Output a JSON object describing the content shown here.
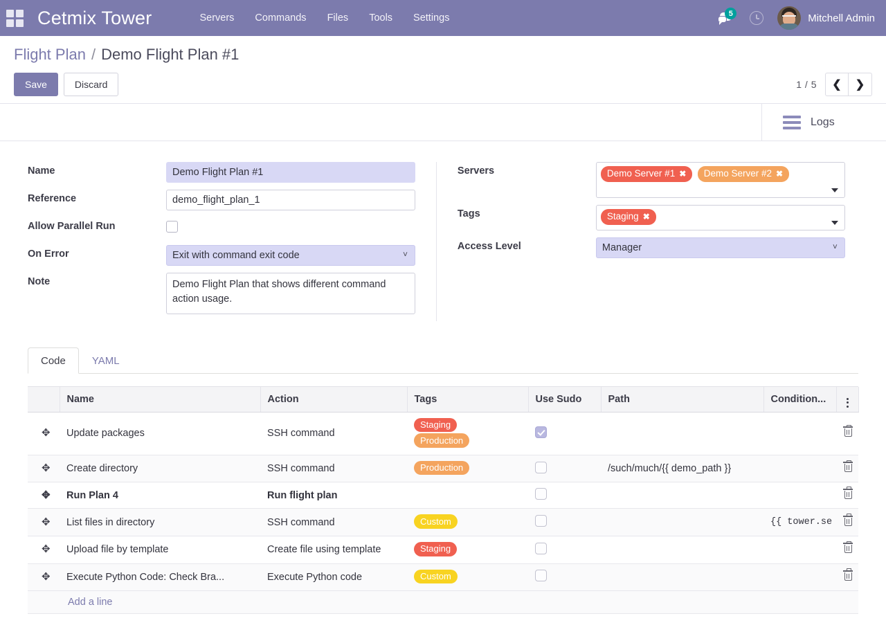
{
  "navbar": {
    "apps_icon": "apps-grid-icon",
    "brand": "Cetmix Tower",
    "menu": [
      "Servers",
      "Commands",
      "Files",
      "Tools",
      "Settings"
    ],
    "messages_icon": "messages-icon",
    "messages_count": "5",
    "activity_icon": "clock-icon",
    "user_name": "Mitchell Admin",
    "avatar_icon": "user-avatar"
  },
  "control_panel": {
    "breadcrumb_root": "Flight Plan",
    "breadcrumb_sep": "/",
    "breadcrumb_current": "Demo Flight Plan #1",
    "save_label": "Save",
    "discard_label": "Discard",
    "pager_value": "1 / 5",
    "prev_icon": "chevron-left-icon",
    "next_icon": "chevron-right-icon"
  },
  "statusbar": {
    "logs_icon": "list-lines-icon",
    "logs_label": "Logs"
  },
  "form": {
    "left": {
      "name_label": "Name",
      "name_value": "Demo Flight Plan #1",
      "reference_label": "Reference",
      "reference_value": "demo_flight_plan_1",
      "allow_parallel_label": "Allow Parallel Run",
      "allow_parallel_checked": false,
      "on_error_label": "On Error",
      "on_error_value": "Exit with command exit code",
      "note_label": "Note",
      "note_value": "Demo Flight Plan that shows different command action usage."
    },
    "right": {
      "servers_label": "Servers",
      "servers_tags": [
        {
          "label": "Demo Server #1",
          "color": "#f06050",
          "remove_icon": "remove-tag-icon"
        },
        {
          "label": "Demo Server #2",
          "color": "#f4a45e",
          "remove_icon": "remove-tag-icon"
        }
      ],
      "tags_label": "Tags",
      "tags_tags": [
        {
          "label": "Staging",
          "color": "#f06050",
          "remove_icon": "remove-tag-icon"
        }
      ],
      "access_level_label": "Access Level",
      "access_level_value": "Manager"
    }
  },
  "notebook": {
    "tabs": [
      {
        "label": "Code",
        "active": true
      },
      {
        "label": "YAML",
        "active": false
      }
    ]
  },
  "lines_table": {
    "headers": {
      "handle": "",
      "name": "Name",
      "action": "Action",
      "tags": "Tags",
      "sudo": "Use Sudo",
      "path": "Path",
      "condition": "Condition...",
      "options_icon": "column-options-icon"
    },
    "rows": [
      {
        "handle_icon": "drag-handle-icon",
        "name": "Update packages",
        "action": "SSH command",
        "tags": [
          {
            "label": "Staging",
            "color": "#f06050"
          },
          {
            "label": "Production",
            "color": "#f4a45e"
          }
        ],
        "sudo": true,
        "path": "",
        "condition": "",
        "bold": false,
        "delete_icon": "trash-icon"
      },
      {
        "handle_icon": "drag-handle-icon",
        "name": "Create directory",
        "action": "SSH command",
        "tags": [
          {
            "label": "Production",
            "color": "#f4a45e"
          }
        ],
        "sudo": false,
        "path": "/such/much/{{ demo_path }}",
        "condition": "",
        "bold": false,
        "delete_icon": "trash-icon"
      },
      {
        "handle_icon": "drag-handle-icon",
        "name": "Run Plan 4",
        "action": "Run flight plan",
        "tags": [],
        "sudo": false,
        "path": "",
        "condition": "",
        "bold": true,
        "delete_icon": "trash-icon"
      },
      {
        "handle_icon": "drag-handle-icon",
        "name": "List files in directory",
        "action": "SSH command",
        "tags": [
          {
            "label": "Custom",
            "color": "#f8d321"
          }
        ],
        "sudo": false,
        "path": "",
        "condition": "{{ tower.se",
        "bold": false,
        "delete_icon": "trash-icon"
      },
      {
        "handle_icon": "drag-handle-icon",
        "name": "Upload file by template",
        "action": "Create file using template",
        "tags": [
          {
            "label": "Staging",
            "color": "#f06050"
          }
        ],
        "sudo": false,
        "path": "",
        "condition": "",
        "bold": false,
        "delete_icon": "trash-icon"
      },
      {
        "handle_icon": "drag-handle-icon",
        "name": "Execute Python Code: Check Bra...",
        "action": "Execute Python code",
        "tags": [
          {
            "label": "Custom",
            "color": "#f8d321"
          }
        ],
        "sudo": false,
        "path": "",
        "condition": "",
        "bold": false,
        "delete_icon": "trash-icon"
      }
    ],
    "add_line_label": "Add a line"
  }
}
